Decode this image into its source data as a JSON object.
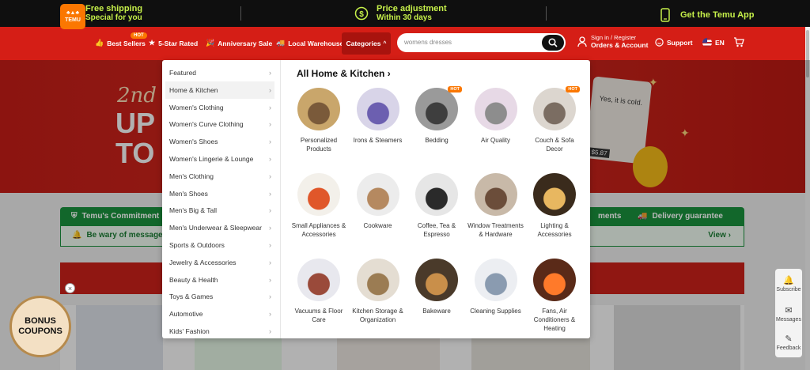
{
  "promo_bar": {
    "free_shipping_title": "Free shipping",
    "free_shipping_sub": "Special for you",
    "price_adjust_title": "Price adjustment",
    "price_adjust_sub": "Within 30 days",
    "get_app": "Get the Temu App"
  },
  "header": {
    "logo_text": "TEMU",
    "nav": {
      "best_sellers": "Best Sellers",
      "hot_badge": "HOT",
      "five_star": "5-Star Rated",
      "anniversary": "Anniversary Sale",
      "local_warehouse": "Local Warehouse",
      "categories": "Categories"
    },
    "search": {
      "value": "womens dresses"
    },
    "account": {
      "line1": "Sign in / Register",
      "line2": "Orders & Account"
    },
    "support": "Support",
    "language": "EN"
  },
  "hero": {
    "script_text": "2nd",
    "line1": "UP",
    "line2": "TO",
    "card_text": "Yes, it is cold.",
    "card_price": "$5.87"
  },
  "commitment": {
    "title": "Temu's Commitment",
    "payments": "ments",
    "delivery": "Delivery guarantee",
    "beware": "Be wary of messages",
    "view": "View"
  },
  "bonus": {
    "line1": "BONUS",
    "line2": "COUPONS",
    "close": "×"
  },
  "side_tools": {
    "subscribe": "Subscribe",
    "messages": "Messages",
    "feedback": "Feedback"
  },
  "dropdown": {
    "categories": [
      "Featured",
      "Home & Kitchen",
      "Women's Clothing",
      "Women's Curve Clothing",
      "Women's Shoes",
      "Women's Lingerie & Lounge",
      "Men's Clothing",
      "Men's Shoes",
      "Men's Big & Tall",
      "Men's Underwear & Sleepwear",
      "Sports & Outdoors",
      "Jewelry & Accessories",
      "Beauty & Health",
      "Toys & Games",
      "Automotive",
      "Kids' Fashion"
    ],
    "active_category": "Home & Kitchen",
    "section_title": "All Home & Kitchen",
    "tiles": [
      {
        "label": "Personalized Products",
        "hot": false
      },
      {
        "label": "Irons & Steamers",
        "hot": false
      },
      {
        "label": "Bedding",
        "hot": true
      },
      {
        "label": "Air Quality",
        "hot": false
      },
      {
        "label": "Couch & Sofa Decor",
        "hot": true
      },
      {
        "label": "Small Appliances & Accessories",
        "hot": false
      },
      {
        "label": "Cookware",
        "hot": false
      },
      {
        "label": "Coffee, Tea & Espresso",
        "hot": false
      },
      {
        "label": "Window Treatments & Hardware",
        "hot": false
      },
      {
        "label": "Lighting & Accessories",
        "hot": false
      },
      {
        "label": "Vacuums & Floor Care",
        "hot": false
      },
      {
        "label": "Kitchen Storage & Organization",
        "hot": false
      },
      {
        "label": "Bakeware",
        "hot": false
      },
      {
        "label": "Cleaning Supplies",
        "hot": false
      },
      {
        "label": "Fans, Air Conditioners & Heating",
        "hot": false
      }
    ],
    "hot_label": "HOT"
  },
  "colors": {
    "brand_red": "#d51e16",
    "brand_orange": "#fb7701",
    "promo_green": "#c6f04a",
    "commit_green": "#1a8f3c"
  }
}
